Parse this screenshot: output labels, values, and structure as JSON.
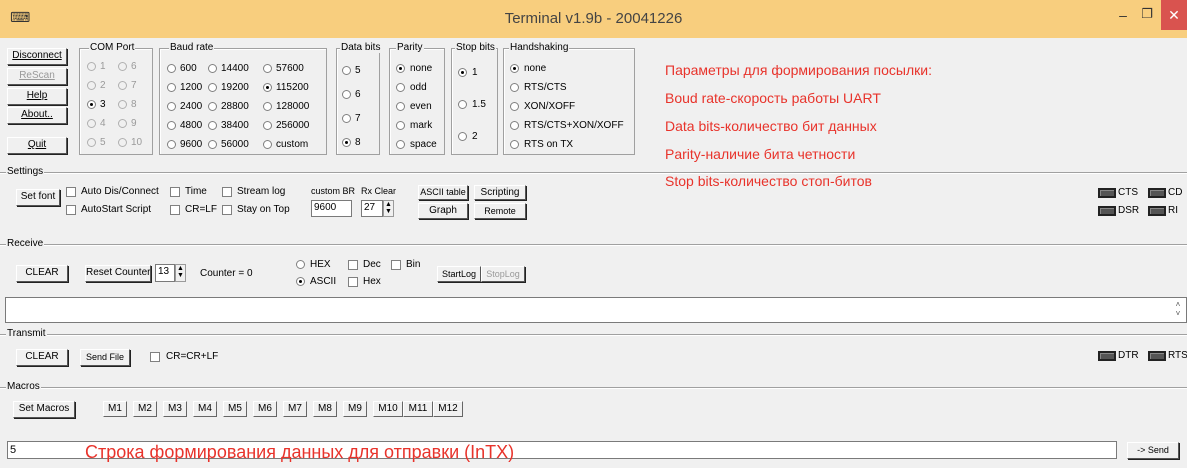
{
  "window": {
    "title": "Terminal v1.9b - 20041226",
    "controls": {
      "minimize": "–",
      "maximize": "❐",
      "close": "✕"
    },
    "app_icon": "terminal-app-icon"
  },
  "connection": {
    "disconnect": "Disconnect",
    "rescan": "ReScan",
    "help": "Help",
    "about": "About..",
    "quit": "Quit"
  },
  "com_port": {
    "label": "COM Port",
    "options": [
      "1",
      "2",
      "3",
      "4",
      "5",
      "6",
      "7",
      "8",
      "9",
      "10"
    ],
    "selected": "3"
  },
  "baud_rate": {
    "label": "Baud rate",
    "options": [
      "600",
      "1200",
      "2400",
      "4800",
      "9600",
      "14400",
      "19200",
      "28800",
      "38400",
      "56000",
      "57600",
      "115200",
      "128000",
      "256000",
      "custom"
    ],
    "selected": "115200"
  },
  "data_bits": {
    "label": "Data bits",
    "options": [
      "5",
      "6",
      "7",
      "8"
    ],
    "selected": "8"
  },
  "parity": {
    "label": "Parity",
    "options": [
      "none",
      "odd",
      "even",
      "mark",
      "space"
    ],
    "selected": "none"
  },
  "stop_bits": {
    "label": "Stop bits",
    "options": [
      "1",
      "1.5",
      "2"
    ],
    "selected": "1"
  },
  "handshaking": {
    "label": "Handshaking",
    "options": [
      "none",
      "RTS/CTS",
      "XON/XOFF",
      "RTS/CTS+XON/XOFF",
      "RTS on TX"
    ],
    "selected": "none"
  },
  "annotations": {
    "lines": [
      "Параметры для формирования посылки:",
      "Boud rate-скорость работы UART",
      "Data bits-количество бит данных",
      "Parity-наличие бита четности",
      "Stop bits-количество стоп-битов"
    ],
    "send_line": "Строка формирования данных для отправки (InTX)"
  },
  "settings": {
    "label": "Settings",
    "set_font": "Set font",
    "checks": {
      "auto_dis_connect": "Auto Dis/Connect",
      "autostart_script": "AutoStart Script",
      "time": "Time",
      "cr_lf": "CR=LF",
      "stream_log": "Stream log",
      "stay_on_top": "Stay on Top"
    },
    "custom_br_label": "custom BR",
    "custom_br_value": "9600",
    "rx_clear_label": "Rx Clear",
    "rx_clear_value": "27",
    "ascii_table": "ASCII table",
    "scripting": "Scripting",
    "graph": "Graph",
    "remote": "Remote"
  },
  "signals": {
    "cts": "CTS",
    "cd": "CD",
    "dsr": "DSR",
    "ri": "RI",
    "dtr": "DTR",
    "rts": "RTS"
  },
  "receive": {
    "label": "Receive",
    "clear": "CLEAR",
    "reset_counter": "Reset Counter",
    "counter_value": "13",
    "counter_text": "Counter = 0",
    "hex": "HEX",
    "ascii": "ASCII",
    "dec": "Dec",
    "bin": "Bin",
    "hex_chk": "Hex",
    "mode_selected": "ASCII",
    "start_log": "StartLog",
    "stop_log": "StopLog"
  },
  "transmit": {
    "label": "Transmit",
    "clear": "CLEAR",
    "send_file": "Send File",
    "cr_crlf": "CR=CR+LF"
  },
  "macros": {
    "label": "Macros",
    "set_macros": "Set Macros",
    "buttons": [
      "M1",
      "M2",
      "M3",
      "M4",
      "M5",
      "M6",
      "M7",
      "M8",
      "M9",
      "M10",
      "M11",
      "M12"
    ]
  },
  "send": {
    "input_value": "5",
    "button": "-> Send"
  },
  "colors": {
    "titlebar": "#f8ce7e",
    "close_button": "#d9534f",
    "annotation": "#e8332b"
  }
}
